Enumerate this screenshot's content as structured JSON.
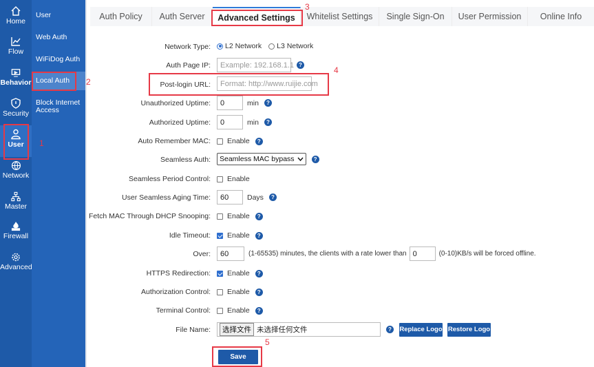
{
  "rail": [
    {
      "id": "home",
      "label": "Home",
      "icon": "home-icon"
    },
    {
      "id": "flow",
      "label": "Flow",
      "icon": "chart-line-icon"
    },
    {
      "id": "behavior",
      "label": "Behavior",
      "icon": "behavior-icon"
    },
    {
      "id": "security",
      "label": "Security",
      "icon": "shield-icon"
    },
    {
      "id": "user",
      "label": "User",
      "icon": "user-icon",
      "active": true
    },
    {
      "id": "network",
      "label": "Network",
      "icon": "globe-icon"
    },
    {
      "id": "master",
      "label": "Master",
      "icon": "org-chart-icon"
    },
    {
      "id": "firewall",
      "label": "Firewall",
      "icon": "firewall-icon"
    },
    {
      "id": "advanced",
      "label": "Advanced",
      "icon": "gear-icon"
    }
  ],
  "subnav": [
    {
      "label": "User"
    },
    {
      "label": "Web Auth"
    },
    {
      "label": "WiFiDog Auth"
    },
    {
      "label": "Local Auth",
      "active": true
    },
    {
      "label": "Block Internet Access"
    }
  ],
  "tabs": [
    {
      "label": "Auth Policy"
    },
    {
      "label": "Auth Server"
    },
    {
      "label": "Advanced Settings",
      "active": true
    },
    {
      "label": "Whitelist Settings"
    },
    {
      "label": "Single Sign-On"
    },
    {
      "label": "User Permission"
    },
    {
      "label": "Online Info"
    }
  ],
  "form": {
    "network_type": {
      "label": "Network Type:",
      "option_l2": "L2 Network",
      "option_l3": "L3 Network",
      "selected": "L2 Network"
    },
    "auth_page_ip": {
      "label": "Auth Page IP:",
      "placeholder": "Example: 192.168.1.1"
    },
    "post_login_url": {
      "label": "Post-login URL:",
      "placeholder": "Format: http://www.ruijie.com"
    },
    "unauthorized_uptime": {
      "label": "Unauthorized Uptime:",
      "value": "0",
      "unit": "min"
    },
    "authorized_uptime": {
      "label": "Authorized Uptime:",
      "value": "0",
      "unit": "min"
    },
    "auto_remember_mac": {
      "label": "Auto Remember MAC:",
      "text": "Enable",
      "checked": false
    },
    "seamless_auth": {
      "label": "Seamless Auth:",
      "value": "Seamless MAC bypass"
    },
    "seamless_period_control": {
      "label": "Seamless Period Control:",
      "text": "Enable",
      "checked": false
    },
    "user_seamless_aging_time": {
      "label": "User Seamless Aging Time:",
      "value": "60",
      "unit": "Days"
    },
    "fetch_mac_dhcp": {
      "label": "Fetch MAC Through DHCP Snooping:",
      "text": "Enable",
      "checked": false
    },
    "idle_timeout": {
      "label": "Idle Timeout:",
      "text": "Enable",
      "checked": true
    },
    "over": {
      "label": "Over:",
      "minutes_value": "60",
      "middle_text": "(1-65535) minutes, the clients with a rate lower than",
      "rate_value": "0",
      "tail_text": "(0-10)KB/s will be forced offline."
    },
    "https_redirection": {
      "label": "HTTPS Redirection:",
      "text": "Enable",
      "checked": true
    },
    "authorization_control": {
      "label": "Authorization Control:",
      "text": "Enable",
      "checked": false
    },
    "terminal_control": {
      "label": "Terminal Control:",
      "text": "Enable",
      "checked": false
    },
    "file_name": {
      "label": "File Name:",
      "choose_button": "选择文件",
      "no_file_text": "未选择任何文件",
      "replace_logo": "Replace Logo",
      "restore_logo": "Restore Logo"
    },
    "save": "Save"
  },
  "annotations": [
    "1",
    "2",
    "3",
    "4",
    "5"
  ],
  "colors": {
    "primary": "#1e5aa8",
    "subnav": "#2464b8",
    "highlight": "#e63946"
  }
}
